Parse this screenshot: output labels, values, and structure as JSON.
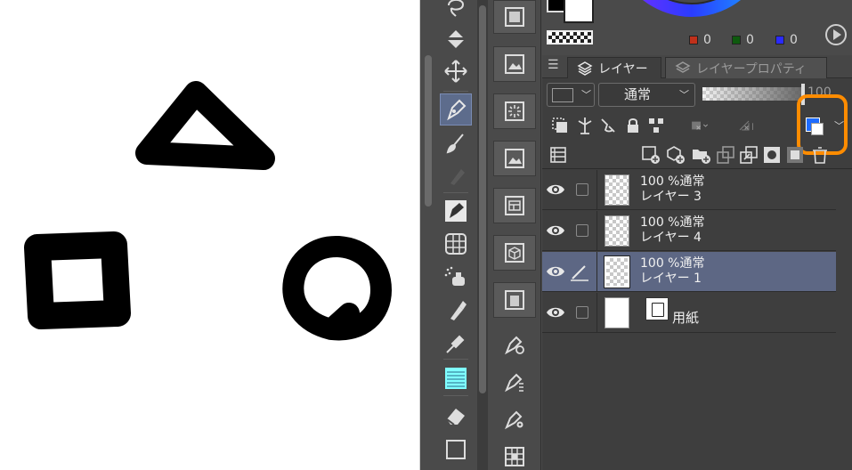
{
  "colors": {
    "accent_highlight": "#ff8c00",
    "selected_row": "#5d6784",
    "panel_background": "#3e3e3e",
    "layer_color_blue": "#1e6cff"
  },
  "canvas": {
    "shapes": [
      "triangle",
      "square",
      "circle"
    ]
  },
  "tools": {
    "items": [
      "lasso-icon",
      "fill-icon",
      "move-icon",
      "pen-icon",
      "brush-icon",
      "airbrush-icon",
      "figure-pen-icon",
      "ruler-grid-icon",
      "spray-icon",
      "glue-bottle-icon",
      "eyedropper-icon",
      "text-lines-icon",
      "eraser-icon",
      "rectangle-icon"
    ]
  },
  "subtools": {
    "items": [
      "material-tone-icon",
      "material-image-icon",
      "material-effect-icon",
      "material-image2-icon",
      "material-layout-icon",
      "material-3d-icon",
      "material-building-icon",
      "pen-settings-icon",
      "pen-tree-icon",
      "pen-gear-icon",
      "grid-palette-icon"
    ]
  },
  "color": {
    "r_value": "0",
    "g_value": "0",
    "b_value": "0"
  },
  "tabs": {
    "layer": "レイヤー",
    "layer_property": "レイヤープロパティ"
  },
  "controls": {
    "blend_mode": "通常",
    "opacity_value": "100"
  },
  "layers": [
    {
      "mode_line": "100 %通常",
      "name": "レイヤー 3",
      "visible": true,
      "selected": false
    },
    {
      "mode_line": "100 %通常",
      "name": "レイヤー 4",
      "visible": true,
      "selected": false
    },
    {
      "mode_line": "100 %通常",
      "name": "レイヤー 1",
      "visible": true,
      "selected": true
    },
    {
      "mode_line": "",
      "name": "用紙",
      "visible": true,
      "selected": false
    }
  ]
}
